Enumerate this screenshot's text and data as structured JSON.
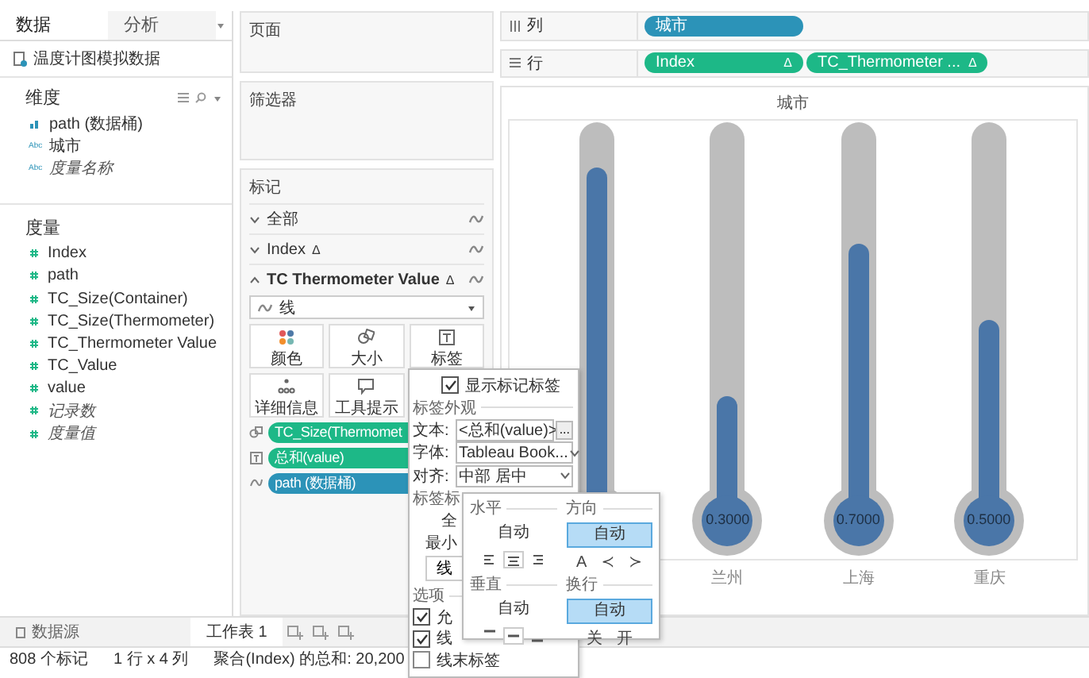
{
  "data_pane": {
    "tabs": [
      {
        "label": "数据",
        "selected": true
      },
      {
        "label": "分析",
        "selected": false
      }
    ],
    "source": "温度计图模拟数据",
    "dimensions": {
      "title": "维度",
      "fields": [
        {
          "name": "path (数据桶)",
          "kind": "bin"
        },
        {
          "name": "城市",
          "kind": "string",
          "icon_text": "Abc"
        },
        {
          "name": "度量名称",
          "kind": "generated",
          "icon_text": "Abc"
        }
      ]
    },
    "measures": {
      "title": "度量",
      "fields": [
        {
          "name": "Index",
          "kind": "field"
        },
        {
          "name": "path",
          "kind": "field"
        },
        {
          "name": "TC_Size(Container)",
          "kind": "field"
        },
        {
          "name": "TC_Size(Thermometer)",
          "kind": "field"
        },
        {
          "name": "TC_Thermometer Value",
          "kind": "field"
        },
        {
          "name": "TC_Value",
          "kind": "field"
        },
        {
          "name": "value",
          "kind": "field"
        },
        {
          "name": "记录数",
          "kind": "generated"
        },
        {
          "name": "度量值",
          "kind": "generated"
        }
      ]
    }
  },
  "pages": {
    "title": "页面"
  },
  "filters": {
    "title": "筛选器"
  },
  "marks": {
    "title": "标记",
    "layers": [
      {
        "label": "全部",
        "expanded": false
      },
      {
        "label": "Index",
        "badge": "Δ",
        "expanded": false
      },
      {
        "label": "TC Thermometer Value",
        "badge": "Δ",
        "expanded": true
      }
    ],
    "mark_type": "线",
    "buttons": [
      {
        "label": "颜色",
        "kind": "color"
      },
      {
        "label": "大小",
        "kind": "size"
      },
      {
        "label": "标签",
        "kind": "label"
      },
      {
        "label": "详细信息",
        "kind": "detail"
      },
      {
        "label": "工具提示",
        "kind": "tooltip"
      }
    ],
    "pills": [
      {
        "label": "TC_Size(Thermomet",
        "kind": "size",
        "color": "#1db887"
      },
      {
        "label": "总和(value)",
        "kind": "label",
        "color": "#1db887"
      },
      {
        "label": "path (数据桶)",
        "kind": "path",
        "color": "#2c93b8"
      }
    ]
  },
  "shelves": [
    {
      "label": "列",
      "kind": "columns",
      "pills": [
        {
          "label": "城市",
          "color": "#2c93b8"
        }
      ]
    },
    {
      "label": "行",
      "kind": "rows",
      "pills": [
        {
          "label": "Index",
          "badge": "Δ",
          "color": "#1db887"
        },
        {
          "label": "TC_Thermometer ...",
          "badge": "Δ",
          "color": "#1db887"
        }
      ]
    }
  ],
  "view": {
    "header": "城市",
    "thermometers": [
      {
        "level": 0.9
      },
      {
        "level": 0.3,
        "reading": "0.3000",
        "city": "兰州"
      },
      {
        "level": 0.7,
        "reading": "0.7000",
        "city": "上海"
      },
      {
        "level": 0.5,
        "reading": "0.5000",
        "city": "重庆"
      }
    ]
  },
  "label_dialog": {
    "show_labels": {
      "label": "显示标记标签",
      "checked": true
    },
    "appearance_title": "标签外观",
    "rows": [
      {
        "label": "文本:",
        "value": "<总和(value)>",
        "kind": "text",
        "more": "..."
      },
      {
        "label": "字体:",
        "value": "Tableau Book...",
        "kind": "select"
      },
      {
        "label": "对齐:",
        "value": "中部 居中",
        "kind": "select"
      }
    ],
    "marks_title": "标签标",
    "marks_lines": [
      "全",
      "最小"
    ],
    "marks_button": "线",
    "options_title": "选项",
    "options": [
      {
        "label": "允",
        "checked": true
      },
      {
        "label": "线",
        "checked": true
      },
      {
        "label": "线末标签",
        "checked": false
      }
    ]
  },
  "alignment_popup": {
    "groups": [
      {
        "title": "水平",
        "value": "自动",
        "selected": false,
        "icons": [
          {
            "kind": "left",
            "selected": false
          },
          {
            "kind": "center",
            "selected": true
          },
          {
            "kind": "right",
            "selected": false
          }
        ]
      },
      {
        "title": "方向",
        "value": "自动",
        "selected": true,
        "options": [
          "A",
          "≺",
          "≻"
        ]
      },
      {
        "title": "垂直",
        "value": "自动",
        "selected": false,
        "icons": [
          {
            "kind": "top",
            "selected": false
          },
          {
            "kind": "middle",
            "selected": true
          },
          {
            "kind": "bottom",
            "selected": false
          }
        ]
      },
      {
        "title": "换行",
        "value": "自动",
        "selected": true,
        "options": [
          "关",
          "开"
        ]
      }
    ]
  },
  "sheet_tabs": [
    {
      "label": "数据源",
      "kind": "datasource",
      "selected": false
    },
    {
      "label": "工作表 1",
      "kind": "sheet",
      "selected": true
    }
  ],
  "status_bar": [
    "808 个标记",
    "1 行 x 4 列",
    "聚合(Index) 的总和: 20,200"
  ]
}
